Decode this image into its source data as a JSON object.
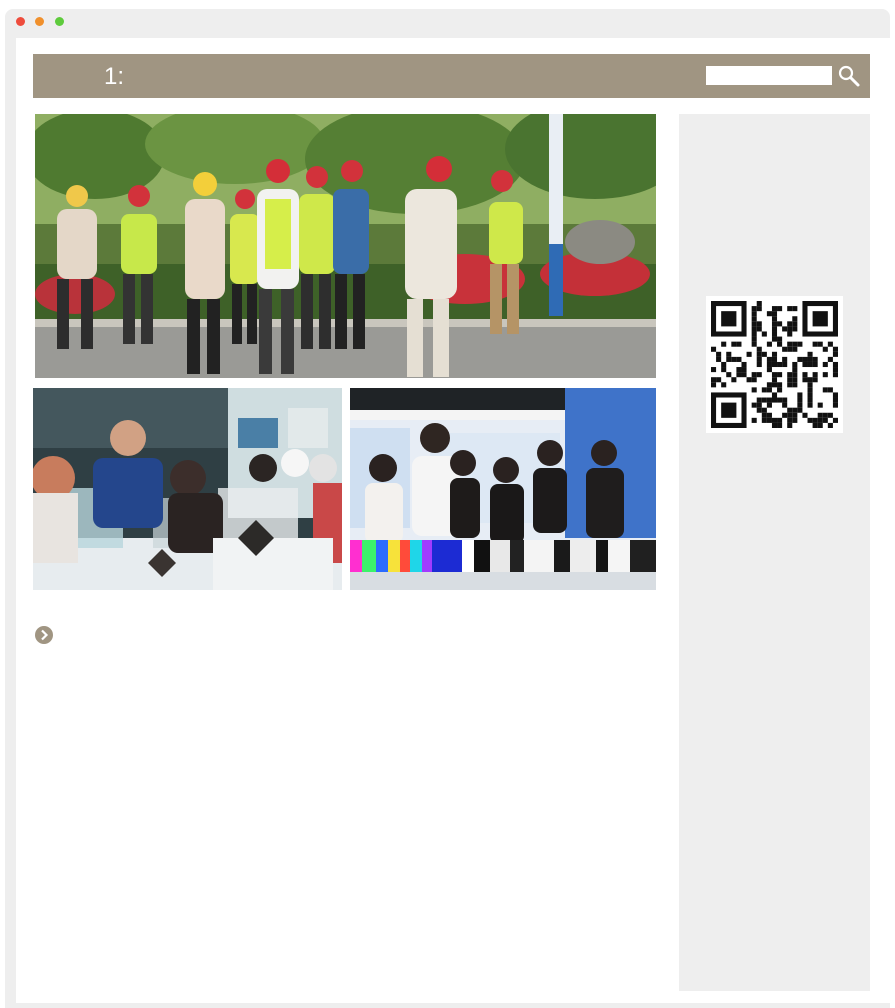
{
  "window": {
    "controls": [
      "close",
      "minimize",
      "maximize"
    ],
    "control_colors": {
      "close": "#ee4c3c",
      "minimize": "#f0902c",
      "maximize": "#5ecb3c"
    }
  },
  "header": {
    "title": "1:",
    "background_color": "#a09582",
    "search": {
      "placeholder": "",
      "value": "",
      "icon": "search-icon"
    }
  },
  "gallery": {
    "main_photo": "photo-group-walking-red-helmets",
    "thumbnails": [
      "photo-exhibit-viewing",
      "photo-showroom-visit"
    ]
  },
  "more_link": {
    "icon": "chevron-right-circle-icon"
  },
  "sidebar": {
    "qr_code": "qr-code"
  },
  "colors": {
    "accent": "#a09582",
    "sidebar_bg": "#eeeeee",
    "frame_bg": "#eeeeee"
  }
}
